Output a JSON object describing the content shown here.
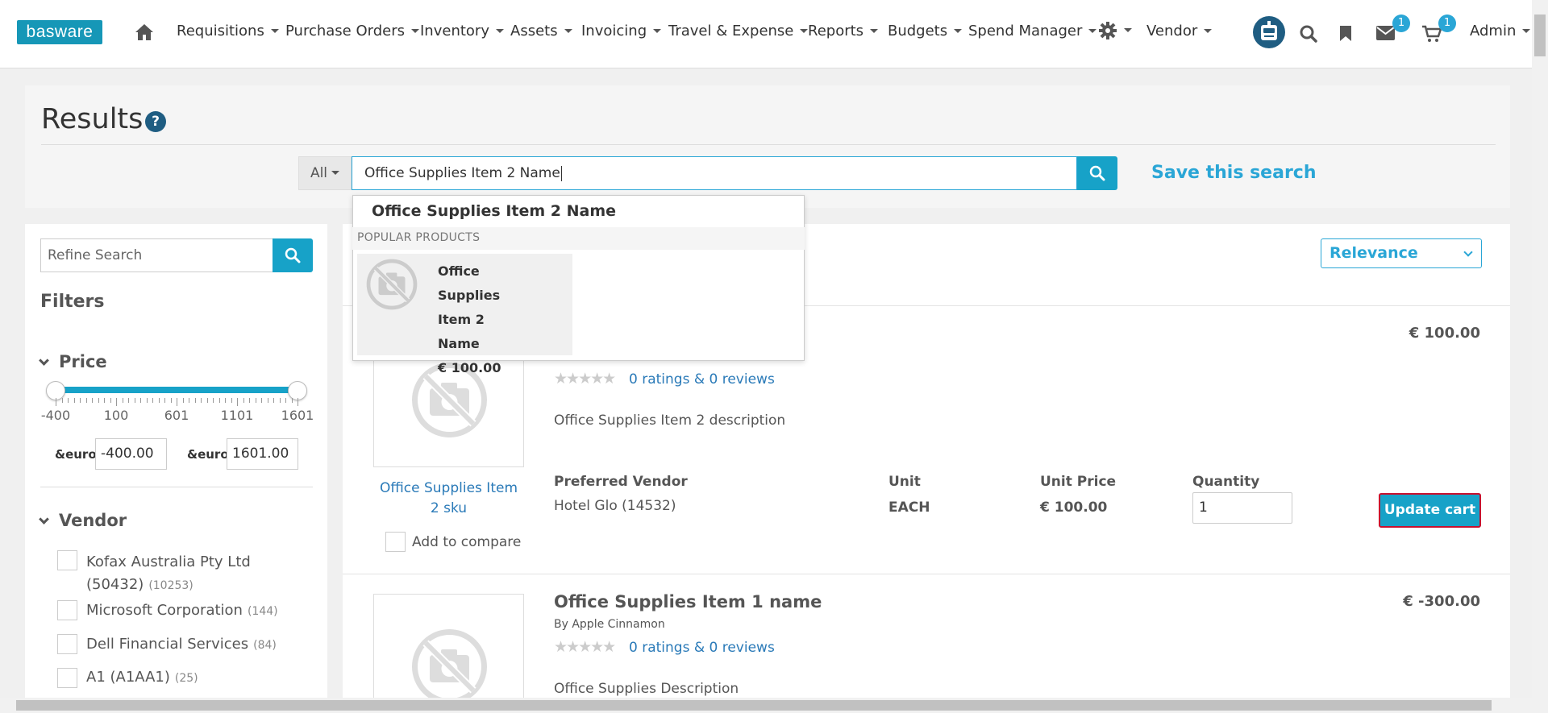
{
  "brand": {
    "logo_text": "basware",
    "accent": "#17a2c8"
  },
  "nav": {
    "items": [
      "Requisitions",
      "Purchase Orders",
      "Inventory",
      "Assets",
      "Invoicing",
      "Travel & Expense",
      "Reports",
      "Budgets",
      "Spend Manager"
    ],
    "vendor": "Vendor",
    "admin": "Admin",
    "mail_badge": "1",
    "cart_badge": "1",
    "icons": [
      "home-icon",
      "gear-icon",
      "robot-icon",
      "search-icon",
      "bookmark-icon",
      "mail-icon",
      "cart-icon"
    ]
  },
  "page": {
    "title": "Results",
    "help": "?"
  },
  "search": {
    "scope": "All",
    "value": "Office Supplies Item 2 Name",
    "save_label": "Save this search"
  },
  "autocomplete": {
    "term": "Office Supplies Item 2 Name",
    "section": "POPULAR PRODUCTS",
    "product_name_lines": [
      "Office",
      "Supplies",
      "Item 2 Name"
    ],
    "product_price": "€ 100.00"
  },
  "sidebar": {
    "refine_placeholder": "Refine Search",
    "filters_title": "Filters",
    "price": {
      "label": "Price",
      "ticks": [
        "-400",
        "100",
        "601",
        "1101",
        "1601"
      ],
      "min_label": "&euro;",
      "max_label": "&euro;",
      "min_value": "-400.00",
      "max_value": "1601.00",
      "range_fraction": [
        0,
        1
      ]
    },
    "vendor": {
      "label": "Vendor",
      "items": [
        {
          "name": "Kofax Australia Pty Ltd",
          "name2": "(50432)",
          "count": "(10253)"
        },
        {
          "name": "Microsoft Corporation",
          "count": "(144)"
        },
        {
          "name": "Dell Financial Services",
          "count": "(84)"
        },
        {
          "name": "A1 (A1AA1)",
          "count": "(25)"
        }
      ]
    }
  },
  "sort": {
    "selected": "Relevance"
  },
  "products": [
    {
      "price": "€ 100.00",
      "rating_text": "0 ratings & 0 reviews",
      "stars": "★★★★★",
      "description": "Office Supplies Item 2 description",
      "sku_link": "Office Supplies Item 2 sku",
      "compare_label": "Add to compare",
      "columns": {
        "vendor_head": "Preferred Vendor",
        "vendor": "Hotel Glo (14532)",
        "unit_head": "Unit",
        "unit": "EACH",
        "unit_price_head": "Unit Price",
        "unit_price": "€ 100.00",
        "qty_head": "Quantity",
        "qty": "1"
      },
      "button": "Update cart"
    },
    {
      "title": "Office Supplies Item 1 name",
      "by": "By Apple Cinnamon",
      "price": "€ -300.00",
      "rating_text": "0 ratings & 0 reviews",
      "stars": "★★★★★",
      "description": "Office Supplies Description"
    }
  ]
}
